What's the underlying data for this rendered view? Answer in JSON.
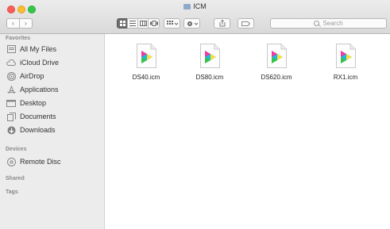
{
  "window": {
    "title": "ICM"
  },
  "toolbar": {
    "back": "‹",
    "forward": "›",
    "search_placeholder": "Search"
  },
  "sidebar": {
    "favorites_header": "Favorites",
    "favorites": [
      {
        "label": "All My Files",
        "icon": "all-files-icon"
      },
      {
        "label": "iCloud Drive",
        "icon": "cloud-icon"
      },
      {
        "label": "AirDrop",
        "icon": "airdrop-icon"
      },
      {
        "label": "Applications",
        "icon": "applications-icon"
      },
      {
        "label": "Desktop",
        "icon": "desktop-icon"
      },
      {
        "label": "Documents",
        "icon": "documents-icon"
      },
      {
        "label": "Downloads",
        "icon": "downloads-icon"
      }
    ],
    "devices_header": "Devices",
    "devices": [
      {
        "label": "Remote Disc",
        "icon": "disc-icon"
      }
    ],
    "shared_header": "Shared",
    "tags_header": "Tags"
  },
  "files": [
    {
      "name": "DS40.icm",
      "icon": "color-profile-icon"
    },
    {
      "name": "DS80.icm",
      "icon": "color-profile-icon"
    },
    {
      "name": "DS620.icm",
      "icon": "color-profile-icon"
    },
    {
      "name": "RX1.icm",
      "icon": "color-profile-icon"
    }
  ]
}
